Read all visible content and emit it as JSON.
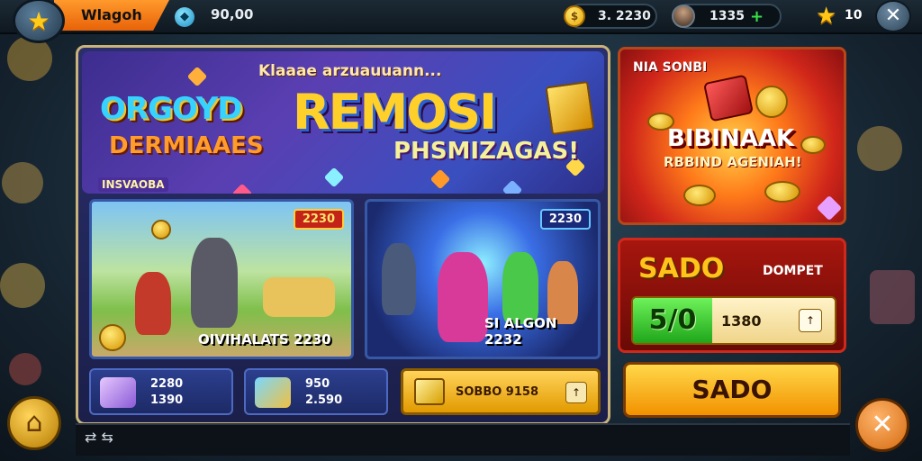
{
  "topbar": {
    "player_name": "Wlagoh",
    "money": "90,00",
    "coins_pill": "3. 2230",
    "friends_pill": "1335",
    "stars": "10",
    "icons": {
      "star": "star-icon",
      "coin": "coin-icon",
      "gem": "gem-icon",
      "avatar": "avatar-icon",
      "plus": "plus-icon",
      "close": "close-icon"
    }
  },
  "banner": {
    "subtitle": "Klaaae arzuauuann...",
    "logo_left1": "ORGOYD",
    "logo_left2": "DERMIAAES",
    "logo_title": "REMOSI",
    "logo_sub": "PHSMIZAGAS!",
    "small_tag": "INSVAOBA"
  },
  "cards": [
    {
      "tag": "2230",
      "label": "OIVIHALATS 2230"
    },
    {
      "tag": "2230",
      "label": "SI ALGON 2232"
    }
  ],
  "bottom_slots": [
    {
      "line1": "2280",
      "line2": "1390"
    },
    {
      "line1": "950",
      "line2": "2.590"
    }
  ],
  "buy_button": {
    "label": "SOBBO 9158",
    "arrow": "↑"
  },
  "promo": {
    "top": "NIA SONBI",
    "big": "BIBINAAK",
    "small": "RBBIND AGENIAH!"
  },
  "sado_panel": {
    "title": "SADO",
    "subtitle": "DOMPET",
    "count": "5/0",
    "value": "1380",
    "arrow": "↑"
  },
  "big_button": {
    "label": "SADO"
  },
  "colors": {
    "accent_orange": "#e86208",
    "gold": "#ffd24a",
    "panel_blue": "#2a2f6b",
    "promo_red": "#d0261a",
    "green": "#1fa61a"
  }
}
